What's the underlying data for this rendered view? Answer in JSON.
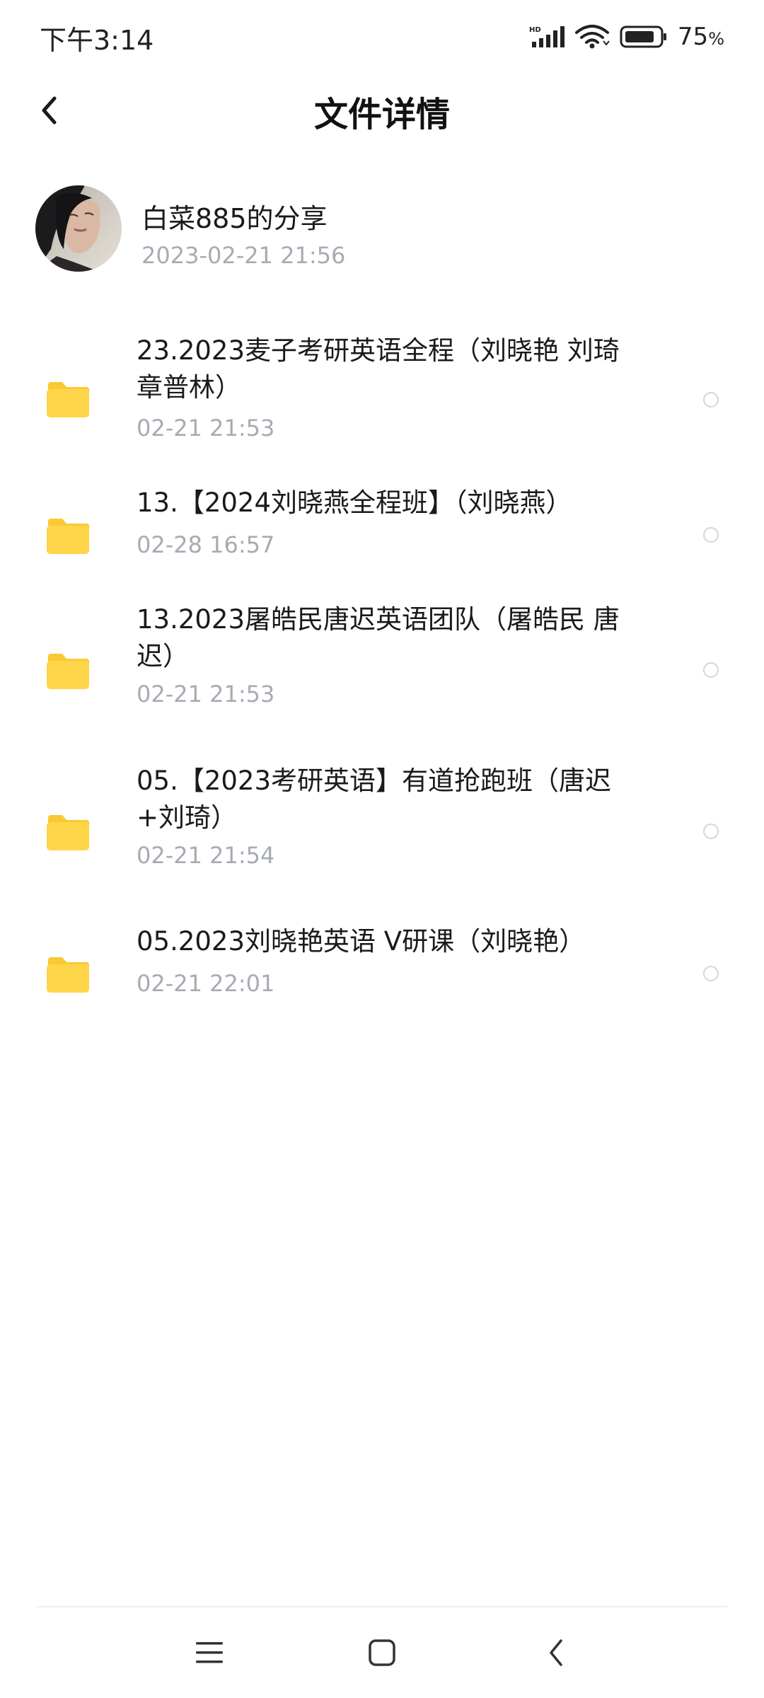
{
  "status_bar": {
    "time": "下午3:14",
    "battery_percent": "75",
    "battery_unit": "%",
    "network_label": "HD",
    "icons": [
      "signal-icon",
      "wifi-icon",
      "battery-icon"
    ]
  },
  "header": {
    "title": "文件详情",
    "back_icon": "back-chevron-icon"
  },
  "sharer": {
    "name": "白菜885的分享",
    "time": "2023-02-21  21:56"
  },
  "files": [
    {
      "name": "23.2023麦子考研英语全程（刘晓艳 刘琦 章普林）",
      "time": "02-21  21:53"
    },
    {
      "name": "13.【2024刘晓燕全程班】（刘晓燕）",
      "time": "02-28  16:57"
    },
    {
      "name": "13.2023屠皓民唐迟英语团队（屠皓民 唐迟）",
      "time": "02-21  21:53"
    },
    {
      "name": "05.【2023考研英语】有道抢跑班（唐迟+刘琦）",
      "time": "02-21  21:54"
    },
    {
      "name": "05.2023刘晓艳英语 V研课（刘晓艳）",
      "time": "02-21  22:01"
    }
  ],
  "colors": {
    "folder": "#FFD54A",
    "folder_tab": "#FBC934",
    "secondary_text": "#A7ABB3",
    "radio_border": "#D4D6DA"
  },
  "nav_bar": {
    "icons": [
      "menu-icon",
      "home-square-icon",
      "back-triangle-icon"
    ]
  }
}
